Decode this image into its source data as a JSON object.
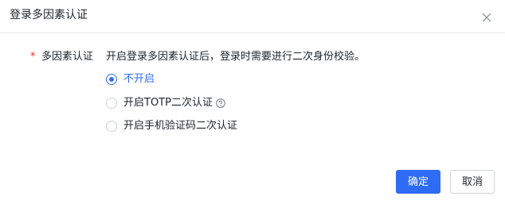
{
  "dialog": {
    "title": "登录多因素认证",
    "close_icon": "close-icon"
  },
  "form": {
    "required_mark": "*",
    "label": "多因素认证",
    "description": "开启登录多因素认证后，登录时需要进行二次身份校验。",
    "options": [
      {
        "label": "不开启",
        "checked": true
      },
      {
        "label": "开启TOTP二次认证",
        "checked": false,
        "help_icon": "question-circle-icon"
      },
      {
        "label": "开启手机验证码二次认证",
        "checked": false
      }
    ]
  },
  "footer": {
    "confirm_label": "确定",
    "cancel_label": "取消"
  },
  "colors": {
    "primary": "#2f6cf6",
    "required": "#f5222d",
    "text": "#1f2329",
    "border": "#d0d3d6"
  }
}
